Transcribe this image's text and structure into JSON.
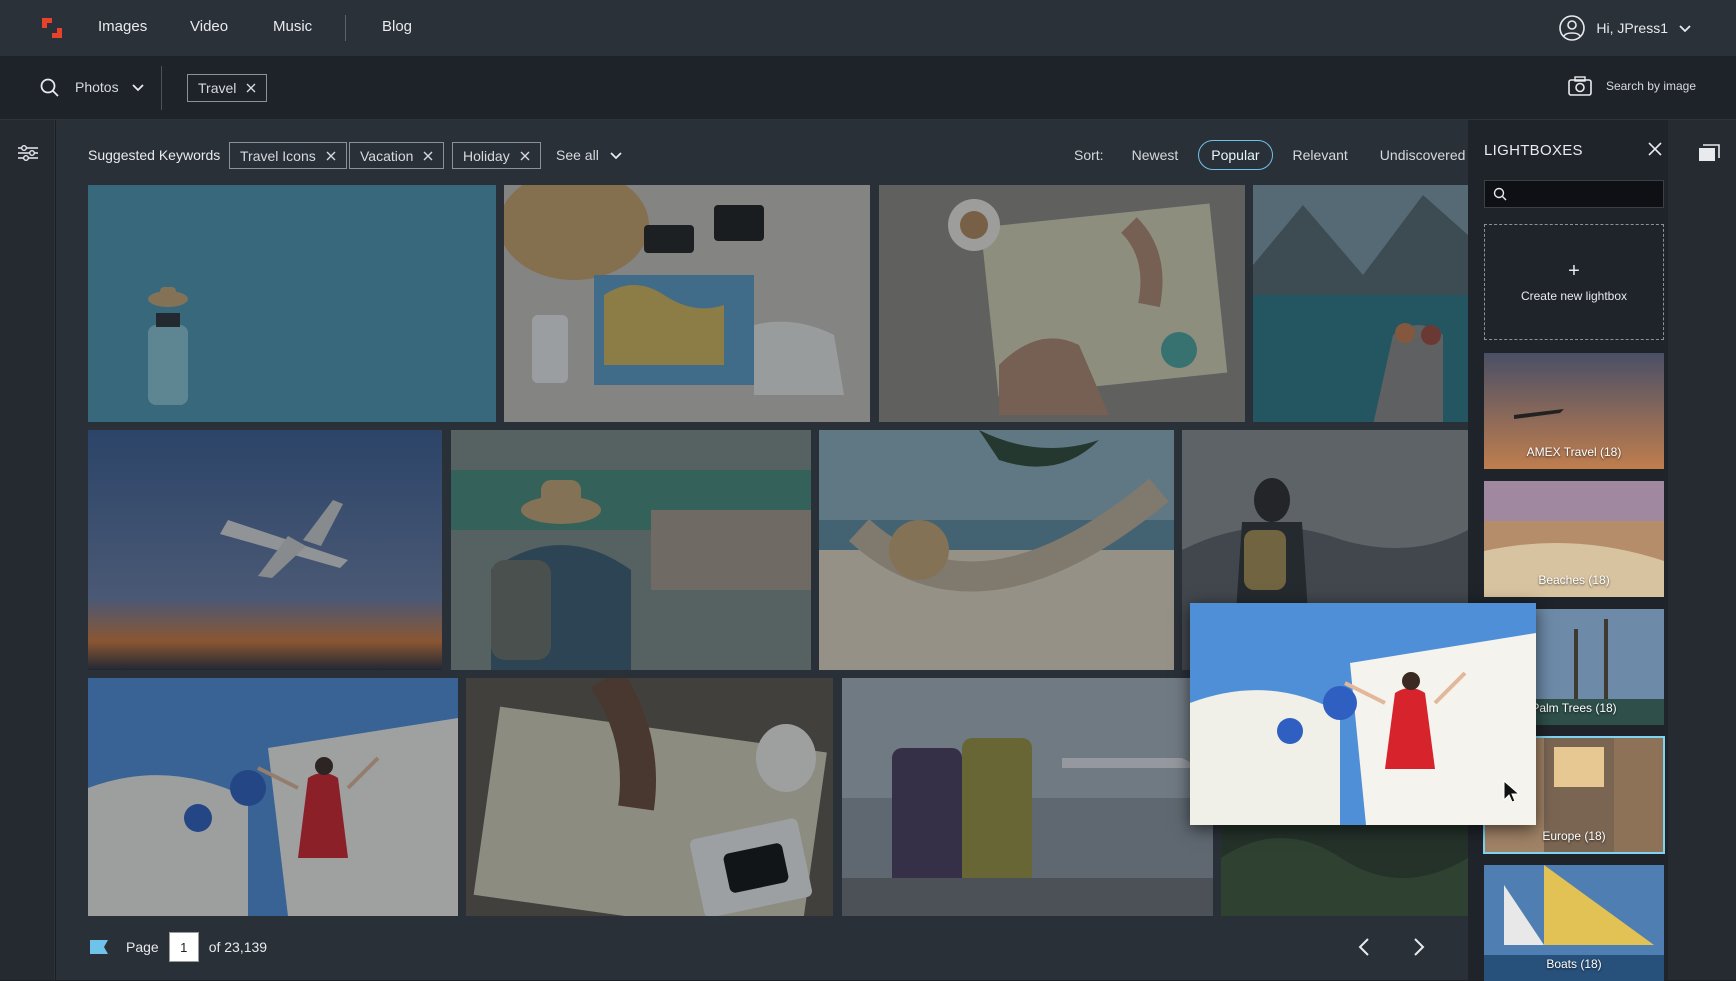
{
  "nav": {
    "items": [
      "Images",
      "Video",
      "Music",
      "Blog"
    ],
    "user_greeting": "Hi, JPress1"
  },
  "search": {
    "media_type": "Photos",
    "query_chip": "Travel",
    "search_by_image": "Search by image"
  },
  "keywords": {
    "label": "Suggested Keywords",
    "chips": [
      "Travel Icons",
      "Vacation",
      "Holiday"
    ],
    "see_all": "See all"
  },
  "sort": {
    "label": "Sort:",
    "options": [
      "Newest",
      "Popular",
      "Relevant",
      "Undiscovered"
    ],
    "active": "Popular"
  },
  "pagination": {
    "page_label": "Page",
    "current_page": "1",
    "total": "of 23,139"
  },
  "lightboxes": {
    "title": "LIGHTBOXES",
    "create_label": "Create new lightbox",
    "items": [
      {
        "name": "AMEX Travel (18)"
      },
      {
        "name": "Beaches (18)"
      },
      {
        "name": "Palm Trees (18)"
      },
      {
        "name": "Europe (18)"
      },
      {
        "name": "Boats (18)"
      }
    ]
  },
  "colors": {
    "accent": "#6fc3e8",
    "logo": "#e8412c",
    "topbar": "#2b3139"
  }
}
